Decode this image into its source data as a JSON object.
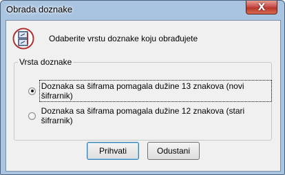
{
  "window": {
    "title": "Obrada doznake",
    "close_symbol": "X"
  },
  "header": {
    "icon": "document-pair-icon",
    "message": "Odaberite vrstu doznake koju obrađujete"
  },
  "group": {
    "legend": "Vrsta doznake",
    "options": [
      {
        "label": "Doznaka sa šiframa pomagala dužine 13 znakova  (novi šifrarnik)",
        "checked": true
      },
      {
        "label": "Doznaka sa šiframa pomagala dužine 12 znakova (stari šifrarnik)",
        "checked": false
      }
    ]
  },
  "buttons": {
    "accept": "Prihvati",
    "cancel": "Odustani"
  },
  "colors": {
    "titlebar": "#a9c4e0",
    "client": "#f0f0f0",
    "close_button": "#c75050"
  }
}
